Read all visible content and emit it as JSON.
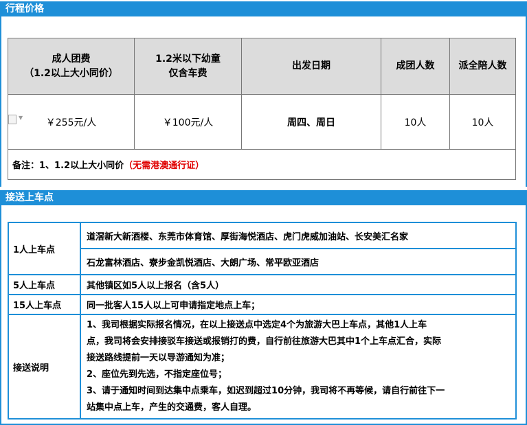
{
  "sections": {
    "price_title": "行程价格",
    "pickup_title": "接送上车点"
  },
  "price_table": {
    "headers": [
      {
        "line1": "成人团费",
        "line2": "（1.2以上大小同价）"
      },
      {
        "line1": "1.2米以下幼童",
        "line2": "仅含车费"
      },
      {
        "line1": "出发日期",
        "line2": ""
      },
      {
        "line1": "成团人数",
        "line2": ""
      },
      {
        "line1": "派全陪人数",
        "line2": ""
      }
    ],
    "row": [
      "￥255元/人",
      "￥100元/人",
      "周四、周日",
      "10人",
      "10人"
    ],
    "note_prefix": "备注：1、1.2以上大小同价",
    "note_red": "（无需港澳通行证）"
  },
  "pickup_table": {
    "rows": [
      {
        "label": "1人上车点",
        "values": [
          "道滘新大新酒楼、东莞市体育馆、厚街海悦酒店、虎门虎威加油站、长安美汇名家",
          "石龙富林酒店、寮步金凯悦酒店、大朗广场、常平欧亚酒店"
        ]
      },
      {
        "label": "5人上车点",
        "values": [
          "其他镇区如5人以上报名（含5人）"
        ]
      },
      {
        "label": "15人上车点",
        "values": [
          "同一批客人15人以上可申请指定地点上车；"
        ]
      },
      {
        "label": "接送说明",
        "lines": [
          "1、我司根据实际报名情况，在以上接送点中选定4个为旅游大巴上车点，其他1人上车",
          "点，我司将会安排接驳车接送或报销打的费，自行前往旅游大巴其中1个上车点汇合，实际",
          "接送路线提前一天以导游通知为准；",
          "2、座位先到先选，不指定座位号；",
          "3、请于通知时间到达集中点乘车，如迟到超过10分钟，我司将不再等候，请自行前往下一",
          "站集中点上车，产生的交通费，客人自理。"
        ]
      }
    ]
  },
  "colors": {
    "accent": "#1e8fd8",
    "header_bg": "#dcdcdc",
    "note_red": "#e00000"
  }
}
